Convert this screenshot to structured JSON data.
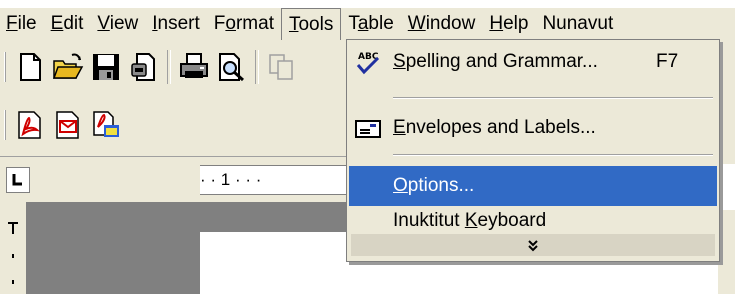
{
  "menubar": {
    "items": [
      {
        "pre": "",
        "u": "F",
        "post": "ile"
      },
      {
        "pre": "",
        "u": "E",
        "post": "dit"
      },
      {
        "pre": "",
        "u": "V",
        "post": "iew"
      },
      {
        "pre": "",
        "u": "I",
        "post": "nsert"
      },
      {
        "pre": "F",
        "u": "o",
        "post": "rmat"
      },
      {
        "pre": "",
        "u": "T",
        "post": "ools"
      },
      {
        "pre": "T",
        "u": "a",
        "post": "ble"
      },
      {
        "pre": "",
        "u": "W",
        "post": "indow"
      },
      {
        "pre": "",
        "u": "H",
        "post": "elp"
      },
      {
        "pre": "Nunavut",
        "u": "",
        "post": ""
      }
    ]
  },
  "ruler": {
    "text": "· · 1 · · ·"
  },
  "tools_menu": {
    "items": [
      {
        "pre": "",
        "u": "S",
        "post": "pelling and Grammar...",
        "shortcut": "F7",
        "icon": "spelling-check-icon"
      },
      {
        "pre": "",
        "u": "E",
        "post": "nvelopes and Labels...",
        "shortcut": "",
        "icon": "envelope-icon"
      },
      {
        "pre": "",
        "u": "O",
        "post": "ptions...",
        "shortcut": "",
        "icon": ""
      },
      {
        "pre": "Inuktitut ",
        "u": "K",
        "post": "eyboard",
        "shortcut": "",
        "icon": ""
      }
    ],
    "expand_glyph": "❯❯"
  },
  "colors": {
    "highlight": "#316ac5",
    "chrome": "#ece9d8"
  },
  "toolbar_icons": [
    "new-document-icon",
    "open-folder-icon",
    "save-icon",
    "permission-icon",
    "print-icon",
    "print-preview-icon",
    "copy-icon",
    "pdf-icon",
    "pdf-email-icon",
    "pdf-review-icon"
  ]
}
